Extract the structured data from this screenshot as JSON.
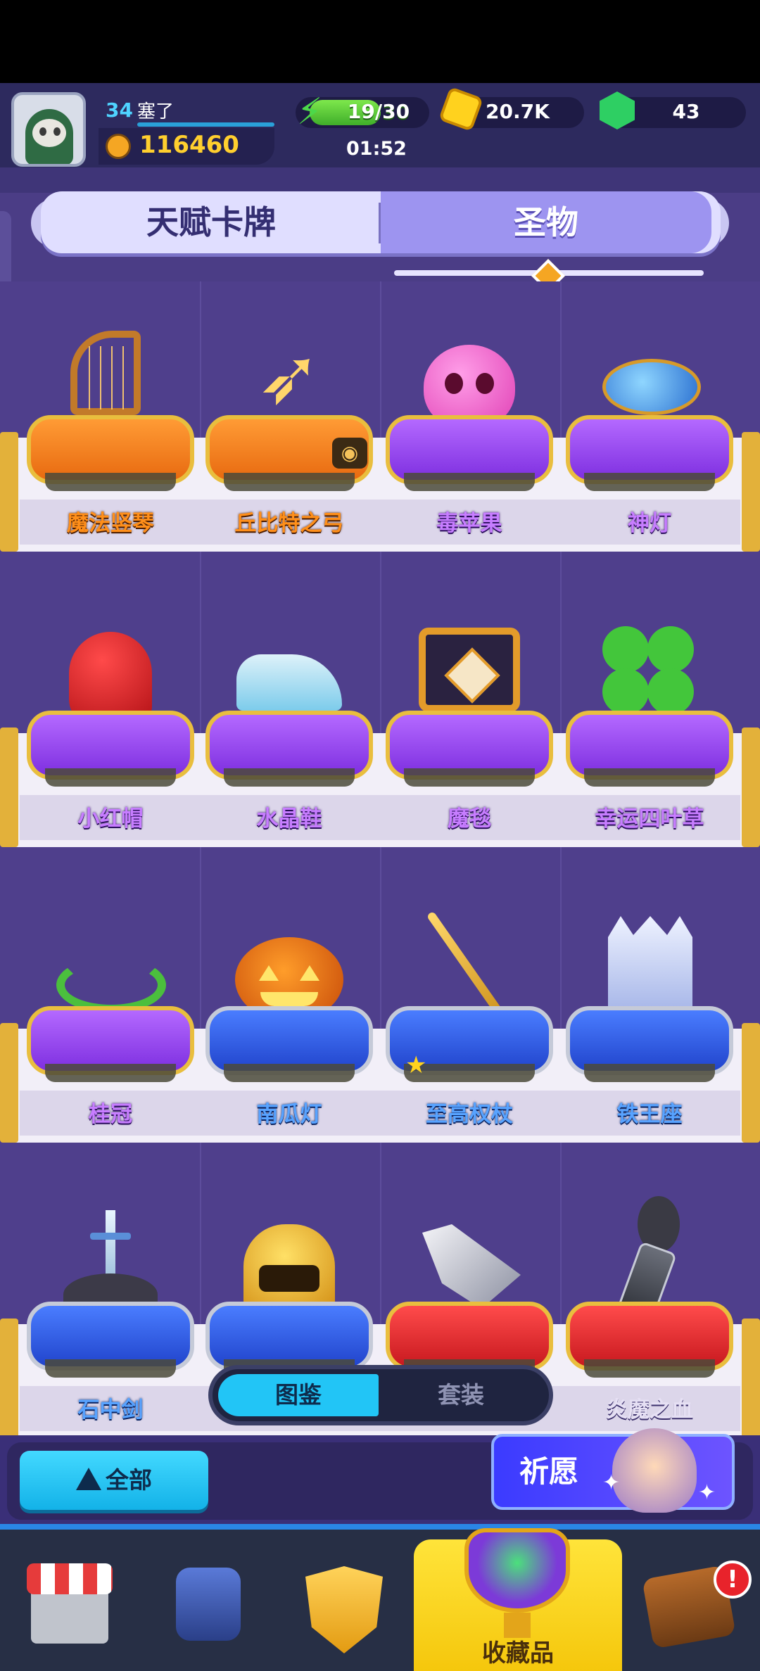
{
  "player": {
    "level": "34",
    "name": "塞了",
    "trophies": "116460"
  },
  "resources": {
    "energy": "19/30",
    "energy_progress": 0.633,
    "energy_timer": "01:52",
    "gold": "20.7K",
    "gems": "43"
  },
  "tabs": {
    "talent_cards": "天赋卡牌",
    "relics": "圣物",
    "selected": "圣物"
  },
  "relics": [
    {
      "name": "魔法竖琴",
      "cushion": "orange"
    },
    {
      "name": "丘比特之弓",
      "cushion": "orange",
      "badge": "eye-icon"
    },
    {
      "name": "毒苹果",
      "cushion": "purple"
    },
    {
      "name": "神灯",
      "cushion": "purple"
    },
    {
      "name": "小红帽",
      "cushion": "purple"
    },
    {
      "name": "水晶鞋",
      "cushion": "purple"
    },
    {
      "name": "魔毯",
      "cushion": "purple"
    },
    {
      "name": "幸运四叶草",
      "cushion": "purple"
    },
    {
      "name": "桂冠",
      "cushion": "purple"
    },
    {
      "name": "南瓜灯",
      "cushion": "blue"
    },
    {
      "name": "至高权杖",
      "cushion": "blue",
      "badge": "star-icon"
    },
    {
      "name": "铁王座",
      "cushion": "blue"
    },
    {
      "name": "石中剑",
      "cushion": "blue"
    },
    {
      "name": "",
      "cushion": "blue"
    },
    {
      "name": "",
      "cushion": "red"
    },
    {
      "name": "炎魔之血",
      "cushion": "red"
    }
  ],
  "view_toggle": {
    "catalog": "图鉴",
    "sets": "套装",
    "selected": "图鉴"
  },
  "actions": {
    "filter_all": "全部",
    "wish": "祈愿"
  },
  "nav": {
    "collection": "收藏品",
    "alert": "!"
  },
  "colors": {
    "background": "#4b3d86",
    "accent_cyan": "#22c5f6",
    "active_nav": "#ffd21e"
  }
}
